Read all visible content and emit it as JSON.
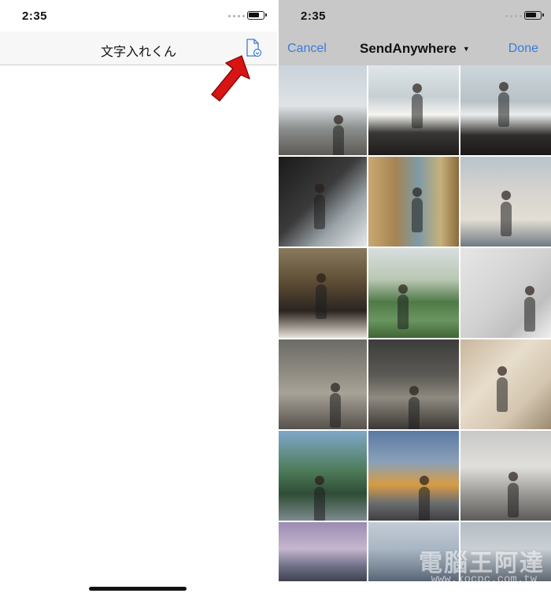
{
  "left_screen": {
    "status_time": "2:35",
    "title": "文字入れくん",
    "doc_icon": "document-download-icon",
    "arrow_icon": "red-pointer-arrow-icon"
  },
  "right_screen": {
    "status_time": "2:35",
    "cancel_label": "Cancel",
    "album_name": "SendAnywhere",
    "album_caret": "▼",
    "done_label": "Done",
    "photos": [
      {
        "bg": "linear-gradient(180deg,#c9d3db 0%,#dfe3e6 45%,#8b8f8e 70%,#5e5a55 100%)"
      },
      {
        "bg": "linear-gradient(180deg,#dfe6ea 0%,#c7cfd3 35%,#f4f4f0 55%,#3a3836 75%,#1f1d1c 100%)"
      },
      {
        "bg": "linear-gradient(180deg,#cdd7dc 0%,#b8c2c6 40%,#e9ecec 55%,#2e2c2b 78%,#1b1a19 100%)"
      },
      {
        "bg": "linear-gradient(135deg,#1a1a1a 0%,#3b3b3b 45%,#9aa3a8 70%,#e5e8ea 100%)"
      },
      {
        "bg": "linear-gradient(90deg,#c9a873 0%,#a58452 30%,#7e9aa6 55%,#c7b07a 80%,#8a6a3c 100%)"
      },
      {
        "bg": "linear-gradient(180deg,#b8c4cc 0%,#d7d4cf 40%,#e3ddd3 70%,#6f7a83 100%)"
      },
      {
        "bg": "linear-gradient(180deg,#8a7a5c 0%,#5a4a33 40%,#2b2420 70%,#e8e2d8 100%)"
      },
      {
        "bg": "linear-gradient(180deg,#d9dde0 0%,#b9c7b3 35%,#4f7a48 60%,#6a9560 80%,#3f6536 100%)"
      },
      {
        "bg": "linear-gradient(135deg,#e6e6e6 0%,#d2d2d2 50%,#bfbfbf 75%,#f0f0f0 100%)"
      },
      {
        "bg": "linear-gradient(180deg,#6b6b66 0%,#8d8a80 35%,#a8a297 60%,#55524c 100%)"
      },
      {
        "bg": "linear-gradient(180deg,#3c3c3a 0%,#5c5a55 40%,#8f8a80 65%,#3a3835 100%)"
      },
      {
        "bg": "linear-gradient(135deg,#c9b79d 0%,#e7ddcc 40%,#d4c6b0 70%,#9b8a72 100%)"
      },
      {
        "bg": "linear-gradient(180deg,#7fa8c9 0%,#4d7a58 45%,#2f4d36 70%,#7c8a8d 100%)"
      },
      {
        "bg": "linear-gradient(180deg,#5b7aa3 0%,#8ba1b8 35%,#d79b43 60%,#6d6e70 80%,#3e3f41 100%)"
      },
      {
        "bg": "linear-gradient(180deg,#c8c8c6 0%,#e0dfdc 40%,#9b9a97 70%,#5c5b59 100%)"
      },
      {
        "bg": "linear-gradient(180deg,#9b8bb3 0%,#c6b6cf 45%,#6d6f86 75%,#3f4150 100%)"
      },
      {
        "bg": "linear-gradient(180deg,#c3ccd6 0%,#a9b6c3 45%,#7f8d9c 75%,#576475 100%)"
      },
      {
        "bg": "linear-gradient(180deg,#b4bcc4 0%,#c9cfd4 45%,#8c959e 75%,#5e6670 100%)"
      }
    ],
    "watermark": "電腦王阿達",
    "watermark_url": "www.kocpc.com.tw"
  }
}
